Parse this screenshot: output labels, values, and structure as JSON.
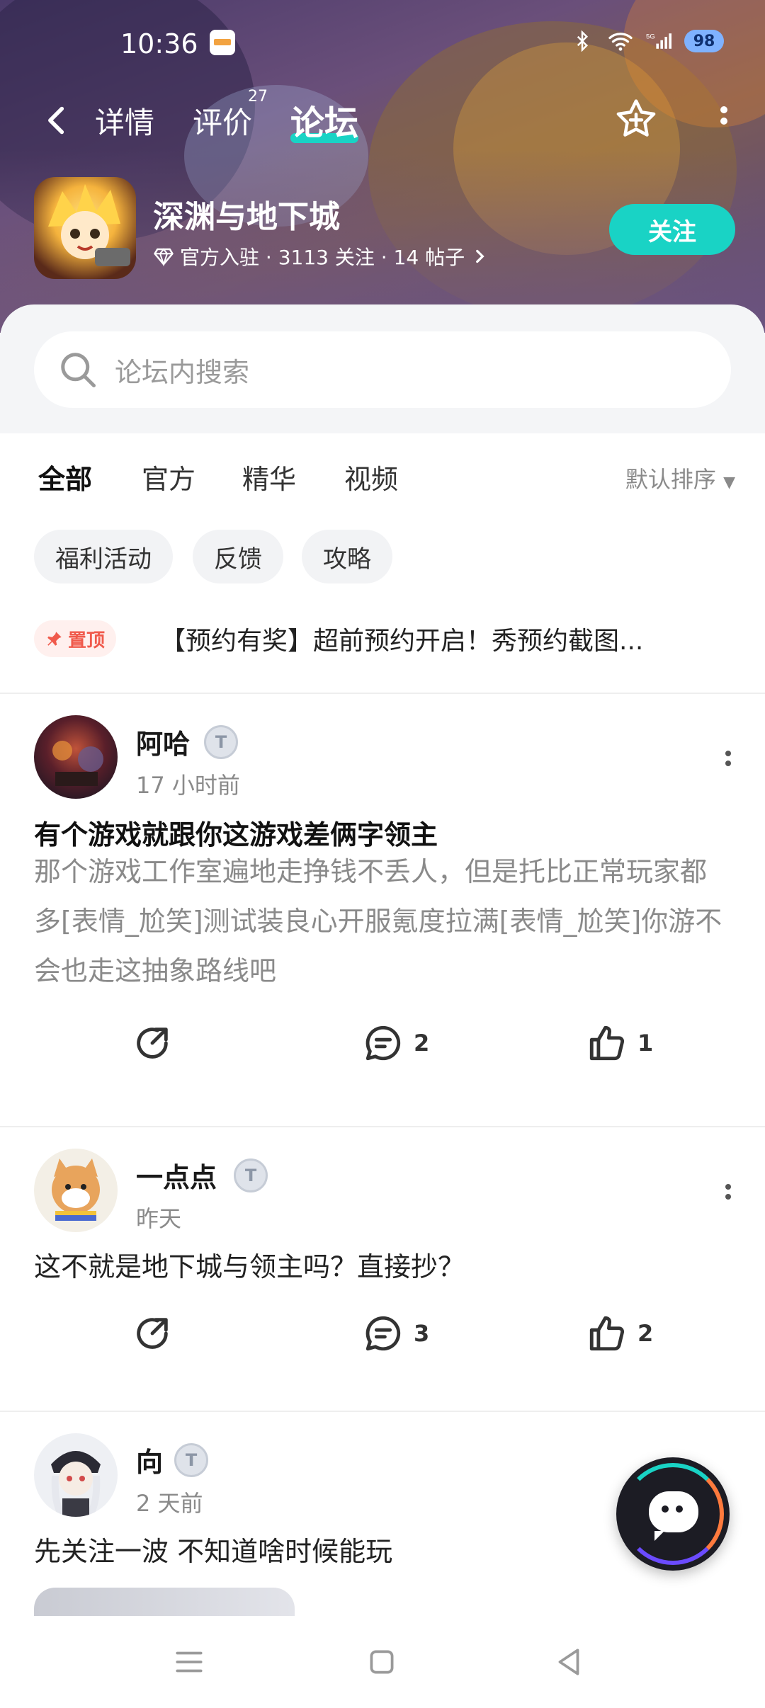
{
  "status_bar": {
    "time": "10:36",
    "battery": "98"
  },
  "header": {
    "tabs": [
      {
        "label": "详情"
      },
      {
        "label": "评价",
        "badge": "27"
      },
      {
        "label": "论坛"
      }
    ],
    "active_tab": "论坛"
  },
  "game": {
    "name": "深渊与地下城",
    "meta": "官方入驻 · 3113 关注 · 14 帖子",
    "follow_label": "关注"
  },
  "search": {
    "placeholder": "论坛内搜索"
  },
  "filter_tabs": [
    {
      "label": "全部"
    },
    {
      "label": "官方"
    },
    {
      "label": "精华"
    },
    {
      "label": "视频"
    }
  ],
  "sort_label": "默认排序",
  "chips": [
    {
      "label": "福利活动"
    },
    {
      "label": "反馈"
    },
    {
      "label": "攻略"
    }
  ],
  "pinned": {
    "tag": "置顶",
    "text": "【预约有奖】超前预约开启！秀预约截图..."
  },
  "posts": [
    {
      "author": "阿哈",
      "level_badge": "T",
      "time": "17 小时前",
      "title": "有个游戏就跟你这游戏差俩字领主",
      "body": "那个游戏工作室遍地走挣钱不丢人，但是托比正常玩家都多[表情_尬笑]测试装良心开服氪度拉满[表情_尬笑]你游不会也走这抽象路线吧",
      "comments": "2",
      "likes": "1"
    },
    {
      "author": "一点点",
      "level_badge": "T",
      "time": "昨天",
      "text": "这不就是地下城与领主吗？直接抄？",
      "comments": "3",
      "likes": "2"
    },
    {
      "author": "向",
      "level_badge": "T",
      "time": "2 天前",
      "text": "先关注一波 不知道啥时候能玩"
    }
  ],
  "colors": {
    "accent": "#19d3c5",
    "pin_red": "#f05a4c"
  }
}
